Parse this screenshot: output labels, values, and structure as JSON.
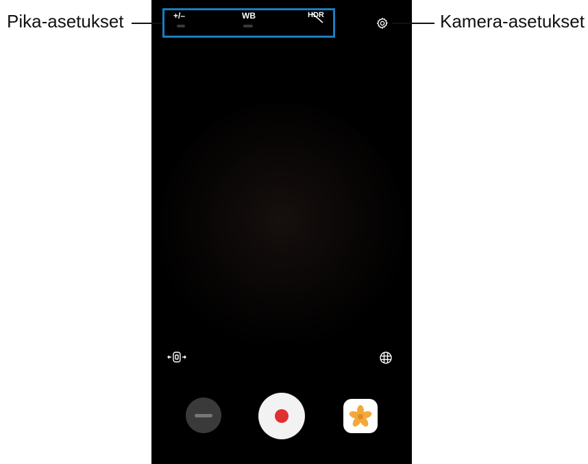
{
  "annotations": {
    "left_label": "Pika-asetukset",
    "right_label": "Kamera-asetukset"
  },
  "quick_settings": {
    "items": [
      {
        "label": "+/–",
        "icon": "exposure-icon"
      },
      {
        "label": "WB",
        "icon": "white-balance-icon"
      },
      {
        "label": "HDR",
        "icon": "hdr-off-icon"
      }
    ],
    "highlight_color": "#1a7fc0"
  },
  "icons": {
    "settings": "gear-icon",
    "stabilization": "stabilization-icon",
    "view_mode": "globe-grid-icon",
    "gallery": "gallery-flower-icon",
    "record": "record-icon"
  },
  "colors": {
    "viewfinder": "#000000",
    "record_dot": "#e03131",
    "flower": "#f2a93b"
  }
}
